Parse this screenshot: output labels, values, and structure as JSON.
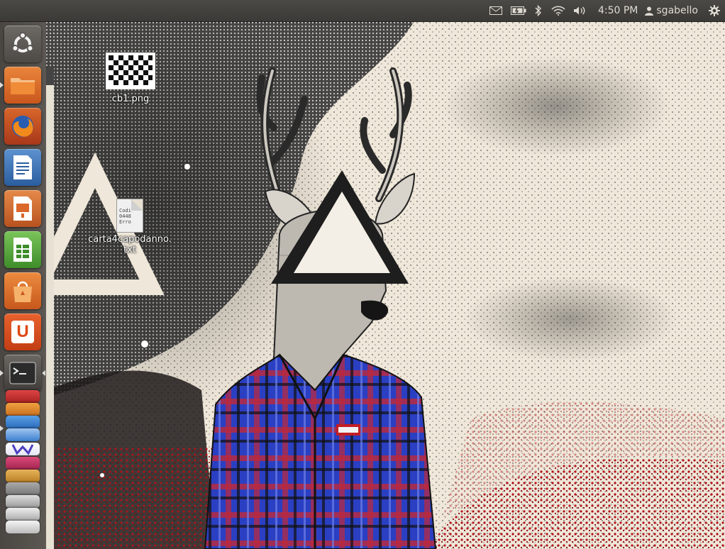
{
  "top_panel": {
    "clock": "4:50 PM",
    "user": "sgabello",
    "icons": [
      "mail-icon",
      "battery-icon",
      "bluetooth-icon",
      "wifi-icon",
      "volume-icon",
      "user-icon",
      "gear-icon"
    ]
  },
  "launcher": {
    "items": [
      {
        "name": "dash-home",
        "icon": "ubuntu-logo-icon"
      },
      {
        "name": "files",
        "icon": "folder-icon"
      },
      {
        "name": "firefox",
        "icon": "firefox-icon"
      },
      {
        "name": "libreoffice-writer",
        "icon": "writer-icon"
      },
      {
        "name": "libreoffice-impress",
        "icon": "impress-icon"
      },
      {
        "name": "libreoffice-calc",
        "icon": "calc-icon"
      },
      {
        "name": "software-center",
        "icon": "shopping-bag-icon"
      },
      {
        "name": "ubuntu-one",
        "icon": "ubuntu-one-icon"
      },
      {
        "name": "terminal",
        "icon": "terminal-icon"
      }
    ],
    "stack_colors": [
      "#c33",
      "#e8942a",
      "#3a7fd6",
      "#5a4fcf",
      "#c23a5a",
      "#d6a040",
      "#888",
      "#aaa",
      "#ccc"
    ]
  },
  "desktop": {
    "icons": [
      {
        "label": "cb1.png",
        "kind": "image"
      },
      {
        "label": "carta4capodanno.\ntxt",
        "kind": "text",
        "preview": "Codi\n0448\nErro"
      }
    ]
  },
  "colors": {
    "panel_bg": "#3c3b37",
    "launcher_bg": "#433f3b",
    "accent_orange": "#dd4814"
  }
}
